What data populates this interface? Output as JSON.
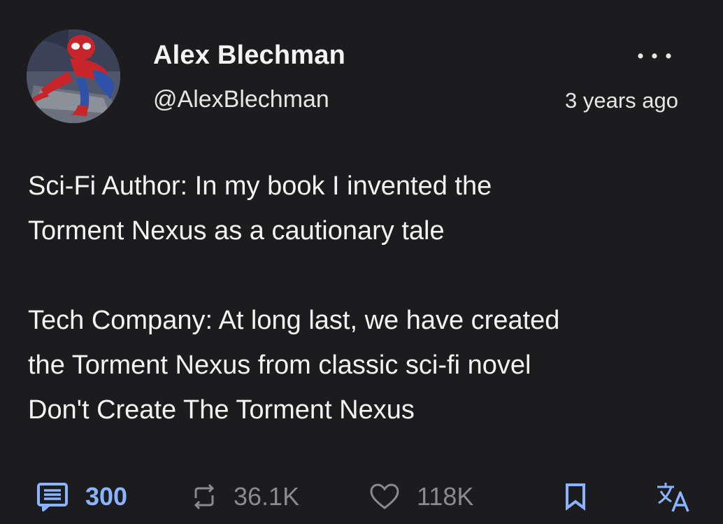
{
  "author": {
    "display_name": "Alex Blechman",
    "handle": "@AlexBlechman",
    "avatar_icon": "spiderman-avatar"
  },
  "post": {
    "timestamp": "3 years ago",
    "paragraphs": [
      "Sci-Fi Author: In my book I invented the",
      "Torment Nexus as a cautionary tale",
      "Tech Company: At long last, we have created",
      "the Torment Nexus from classic sci-fi novel",
      "Don't Create The Torment Nexus"
    ]
  },
  "actions": {
    "reply": {
      "icon": "comment-icon",
      "count": "300",
      "color": "#8ab4ff"
    },
    "repost": {
      "icon": "repost-icon",
      "count": "36.1K",
      "color": "#8a8a8f"
    },
    "like": {
      "icon": "heart-icon",
      "count": "118K",
      "color": "#8a8a8f"
    },
    "bookmark": {
      "icon": "bookmark-icon",
      "color": "#8ab4ff"
    },
    "translate": {
      "icon": "translate-icon",
      "color": "#8ab4ff"
    }
  },
  "colors": {
    "background": "#1c1c1e",
    "text": "#f4f4f4",
    "accent": "#8ab4ff",
    "muted": "#8a8a8f"
  }
}
